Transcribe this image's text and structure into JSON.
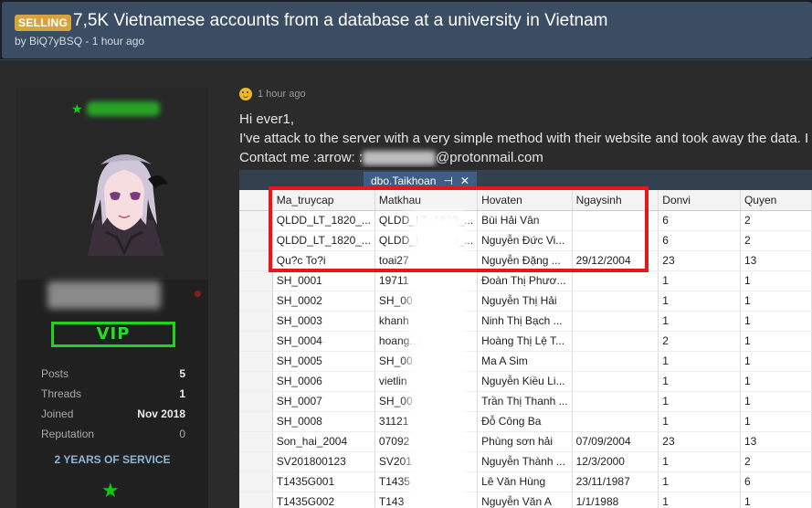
{
  "thread": {
    "badge": "SELLING",
    "title": "7,5K Vietnamese accounts from a database at a university in Vietnam",
    "meta": "by BiQ7yBSQ - 1 hour ago"
  },
  "author": {
    "rank_label": "VIP",
    "stats": [
      {
        "label": "Posts",
        "value": "5"
      },
      {
        "label": "Threads",
        "value": "1"
      },
      {
        "label": "Joined",
        "value": "Nov 2018"
      },
      {
        "label": "Reputation",
        "value": "0"
      }
    ],
    "service": "2 YEARS OF SERVICE",
    "colors": {
      "username": "#27b227",
      "vip": "#1ed41e",
      "service": "#8fb5d6"
    }
  },
  "post": {
    "time": "1 hour ago",
    "lines": [
      "Hi ever1,",
      "I've attack to the server with a very simple method with their website and took away the data. I"
    ],
    "contact_prefix": "Contact me :arrow: :",
    "contact_suffix": "@protonmail.com"
  },
  "screenshot": {
    "tab_label": "dbo.Taikhoan",
    "tab_pin": "⊣",
    "tab_close": "✕",
    "columns": [
      "Ma_truycap",
      "Matkhau",
      "Hovaten",
      "Ngaysinh",
      "Donvi",
      "Quyen"
    ],
    "rows": [
      [
        "QLDD_LT_1820_...",
        "QLDD_LT_1820_...",
        "Bùi Hải Vân",
        "",
        "6",
        "2"
      ],
      [
        "QLDD_LT_1820_...",
        "QLDD_LT_1820_...",
        "Nguyễn Đức Vi...",
        "",
        "6",
        "2"
      ],
      [
        "Qu?c To?i",
        "toai27",
        "Nguyễn Đặng ...",
        "29/12/2004",
        "23",
        "13"
      ],
      [
        "SH_0001",
        "19711",
        "Đoàn Thị Phươ...",
        "",
        "1",
        "1"
      ],
      [
        "SH_0002",
        "SH_00",
        "Nguyễn Thị Hải",
        "",
        "1",
        "1"
      ],
      [
        "SH_0003",
        "khanh",
        "Ninh Thị Bạch ...",
        "",
        "1",
        "1"
      ],
      [
        "SH_0004",
        "hoang...23",
        "Hoàng Thị Lệ T...",
        "",
        "2",
        "1"
      ],
      [
        "SH_0005",
        "SH_00",
        "Ma A Sim",
        "",
        "1",
        "1"
      ],
      [
        "SH_0006",
        "vietlin",
        "Nguyễn Kiều Li...",
        "",
        "1",
        "1"
      ],
      [
        "SH_0007",
        "SH_00",
        "Trần Thị Thanh ...",
        "",
        "1",
        "1"
      ],
      [
        "SH_0008",
        "31121",
        "Đỗ Công Ba",
        "",
        "1",
        "1"
      ],
      [
        "Son_hai_2004",
        "07092",
        "Phùng sơn hải",
        "07/09/2004",
        "23",
        "13"
      ],
      [
        "SV201800123",
        "SV201",
        "Nguyễn Thành ...",
        "12/3/2000",
        "1",
        "2"
      ],
      [
        "T1435G001",
        "T1435",
        "Lê Văn Hùng",
        "23/11/1987",
        "1",
        "6"
      ],
      [
        "T1435G002",
        "T143",
        "Nguyễn Văn A",
        "1/1/1988",
        "1",
        "1"
      ]
    ]
  }
}
